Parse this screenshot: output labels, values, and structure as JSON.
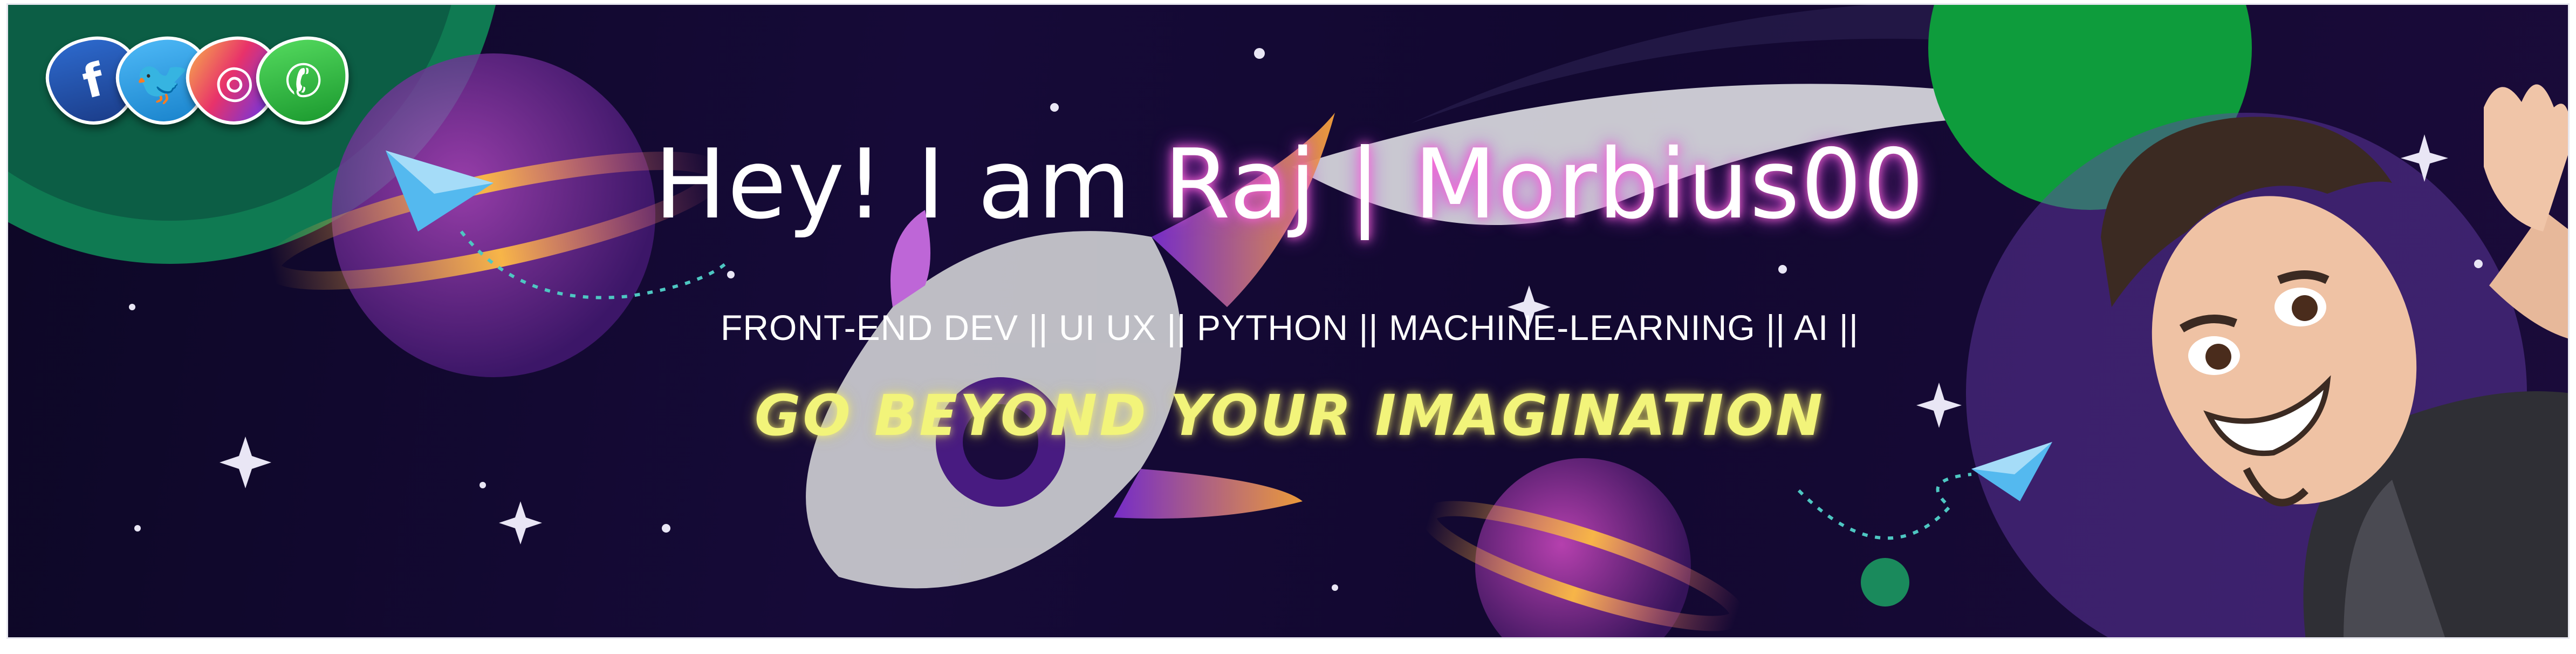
{
  "banner": {
    "heading_prefix": "Hey! I am ",
    "heading_name": "Raj | Morbius00",
    "roles": "FRONT-END DEV || UI UX || PYTHON || MACHINE-LEARNING || AI ||",
    "tagline": "GO BEYOND YOUR IMAGINATION"
  },
  "social_links": [
    {
      "name": "facebook",
      "icon": "facebook-icon",
      "glyph": "f",
      "color": "#2c67c9"
    },
    {
      "name": "twitter",
      "icon": "twitter-icon",
      "glyph": "🐦",
      "color": "#1d9bf0"
    },
    {
      "name": "instagram",
      "icon": "instagram-icon",
      "glyph": "◎",
      "color": "#e1306c"
    },
    {
      "name": "whatsapp",
      "icon": "whatsapp-icon",
      "glyph": "✆",
      "color": "#25d366"
    }
  ],
  "colors": {
    "background": "#120830",
    "heading": "#ffffff",
    "name_glow": "#ff6bd7",
    "tagline": "#f2f47a"
  }
}
